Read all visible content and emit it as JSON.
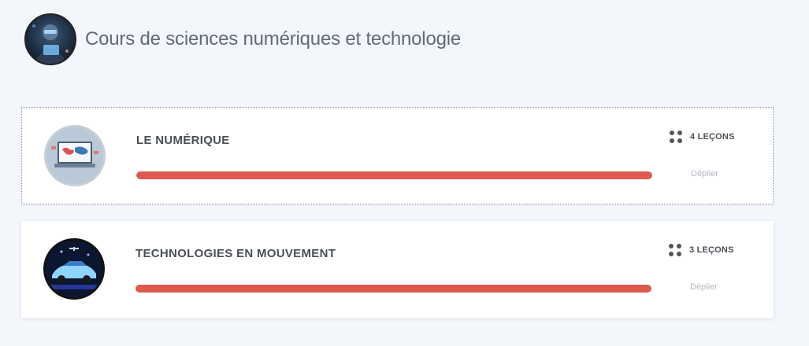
{
  "header": {
    "title": "Cours de sciences numériques et technologie",
    "avatar_icon": "robot-tech-avatar-icon"
  },
  "courses": [
    {
      "title": "LE NUMÉRIQUE",
      "lessons_label": "4 LEÇONS",
      "expand_label": "Déplier",
      "progress": 1.0,
      "thumbnail_icon": "laptop-world-map-icon"
    },
    {
      "title": "TECHNOLOGIES EN MOUVEMENT",
      "lessons_label": "3 LEÇONS",
      "expand_label": "Déplier",
      "progress": 1.0,
      "thumbnail_icon": "car-drone-icon"
    }
  ],
  "colors": {
    "background": "#f3f6fb",
    "progress": "#dc5a4e",
    "title_text": "#5f6b77"
  }
}
